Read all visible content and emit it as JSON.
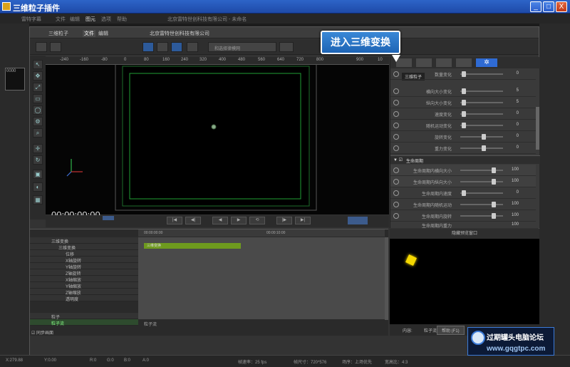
{
  "window": {
    "title": "三维粒子插件",
    "min": "_",
    "max": "□",
    "close": "X"
  },
  "outer_menu": [
    "雷特字幕",
    "文件",
    "编辑",
    "图元",
    "选项",
    "帮助"
  ],
  "outer_company": "北京雷特世创科技有限公司 - 未命名",
  "thumbnail_label": "0000",
  "inner": {
    "title_label": "三维粒子",
    "tabs": [
      "文件",
      "编辑"
    ],
    "company": "北京雷特世创科技有限公司",
    "dropdown_value": "和选择律模网"
  },
  "ruler_ticks": [
    "-240",
    "-160",
    "-80",
    "0",
    "80",
    "160",
    "240",
    "320",
    "400",
    "480",
    "560",
    "640",
    "720",
    "800",
    "900",
    "10"
  ],
  "timecode": "00:00:00:00",
  "callout": "进入三维变换",
  "props": {
    "section1_title": "三维粒子",
    "rows1": [
      {
        "name": "数量变化",
        "value": "0"
      },
      {
        "name": "横向大小变化",
        "value": "5"
      },
      {
        "name": "纵向大小变化",
        "value": "5"
      },
      {
        "name": "速度变化",
        "value": "0"
      },
      {
        "name": "随机运动变化",
        "value": "0"
      },
      {
        "name": "旋转变化",
        "value": "0"
      },
      {
        "name": "重力变化",
        "value": "0"
      }
    ],
    "section2_title": "生命周期",
    "rows2": [
      {
        "name": "生命周期内横向大小",
        "value": "100"
      },
      {
        "name": "生命周期内纵向大小",
        "value": "100"
      },
      {
        "name": "生命周期内速度",
        "value": "0"
      },
      {
        "name": "生命周期内随机运动",
        "value": "100"
      },
      {
        "name": "生命周期内旋转",
        "value": "100"
      },
      {
        "name": "生命周期内重力",
        "value": "100"
      }
    ]
  },
  "timeline": {
    "time_start": "00:00:00:00",
    "time_mid": "00:00:10:00",
    "clip_label": "三维变换",
    "tracks": [
      "三维变换",
      "三维变换",
      "位移",
      "X轴旋转",
      "Y轴旋转",
      "Z轴旋转",
      "X轴缩放",
      "Y轴缩放",
      "Z轴缩放",
      "透明度",
      "粒子",
      "粒子流"
    ],
    "bottom_label": "粒子流",
    "sync_label": "同步画面"
  },
  "preview_label": "隐藏预览窗口",
  "preview_footer": {
    "content": "内容:",
    "value": "粒子流",
    "help": "帮助 (F1)"
  },
  "status": [
    "X:279.88",
    "Y:0.00",
    "R:0",
    "G:0",
    "B:0",
    "A:0",
    "帧速率：25 fps",
    "帧尺寸：720*576",
    "场序：上场优先",
    "宽高比：4:3"
  ],
  "watermark": {
    "line1": "过期罐头电脑论坛",
    "line2": "www.gqgtpc.com"
  },
  "colors": {
    "accent": "#3a88d6",
    "track_green": "#6e9a1e",
    "particle": "#f5d800"
  }
}
